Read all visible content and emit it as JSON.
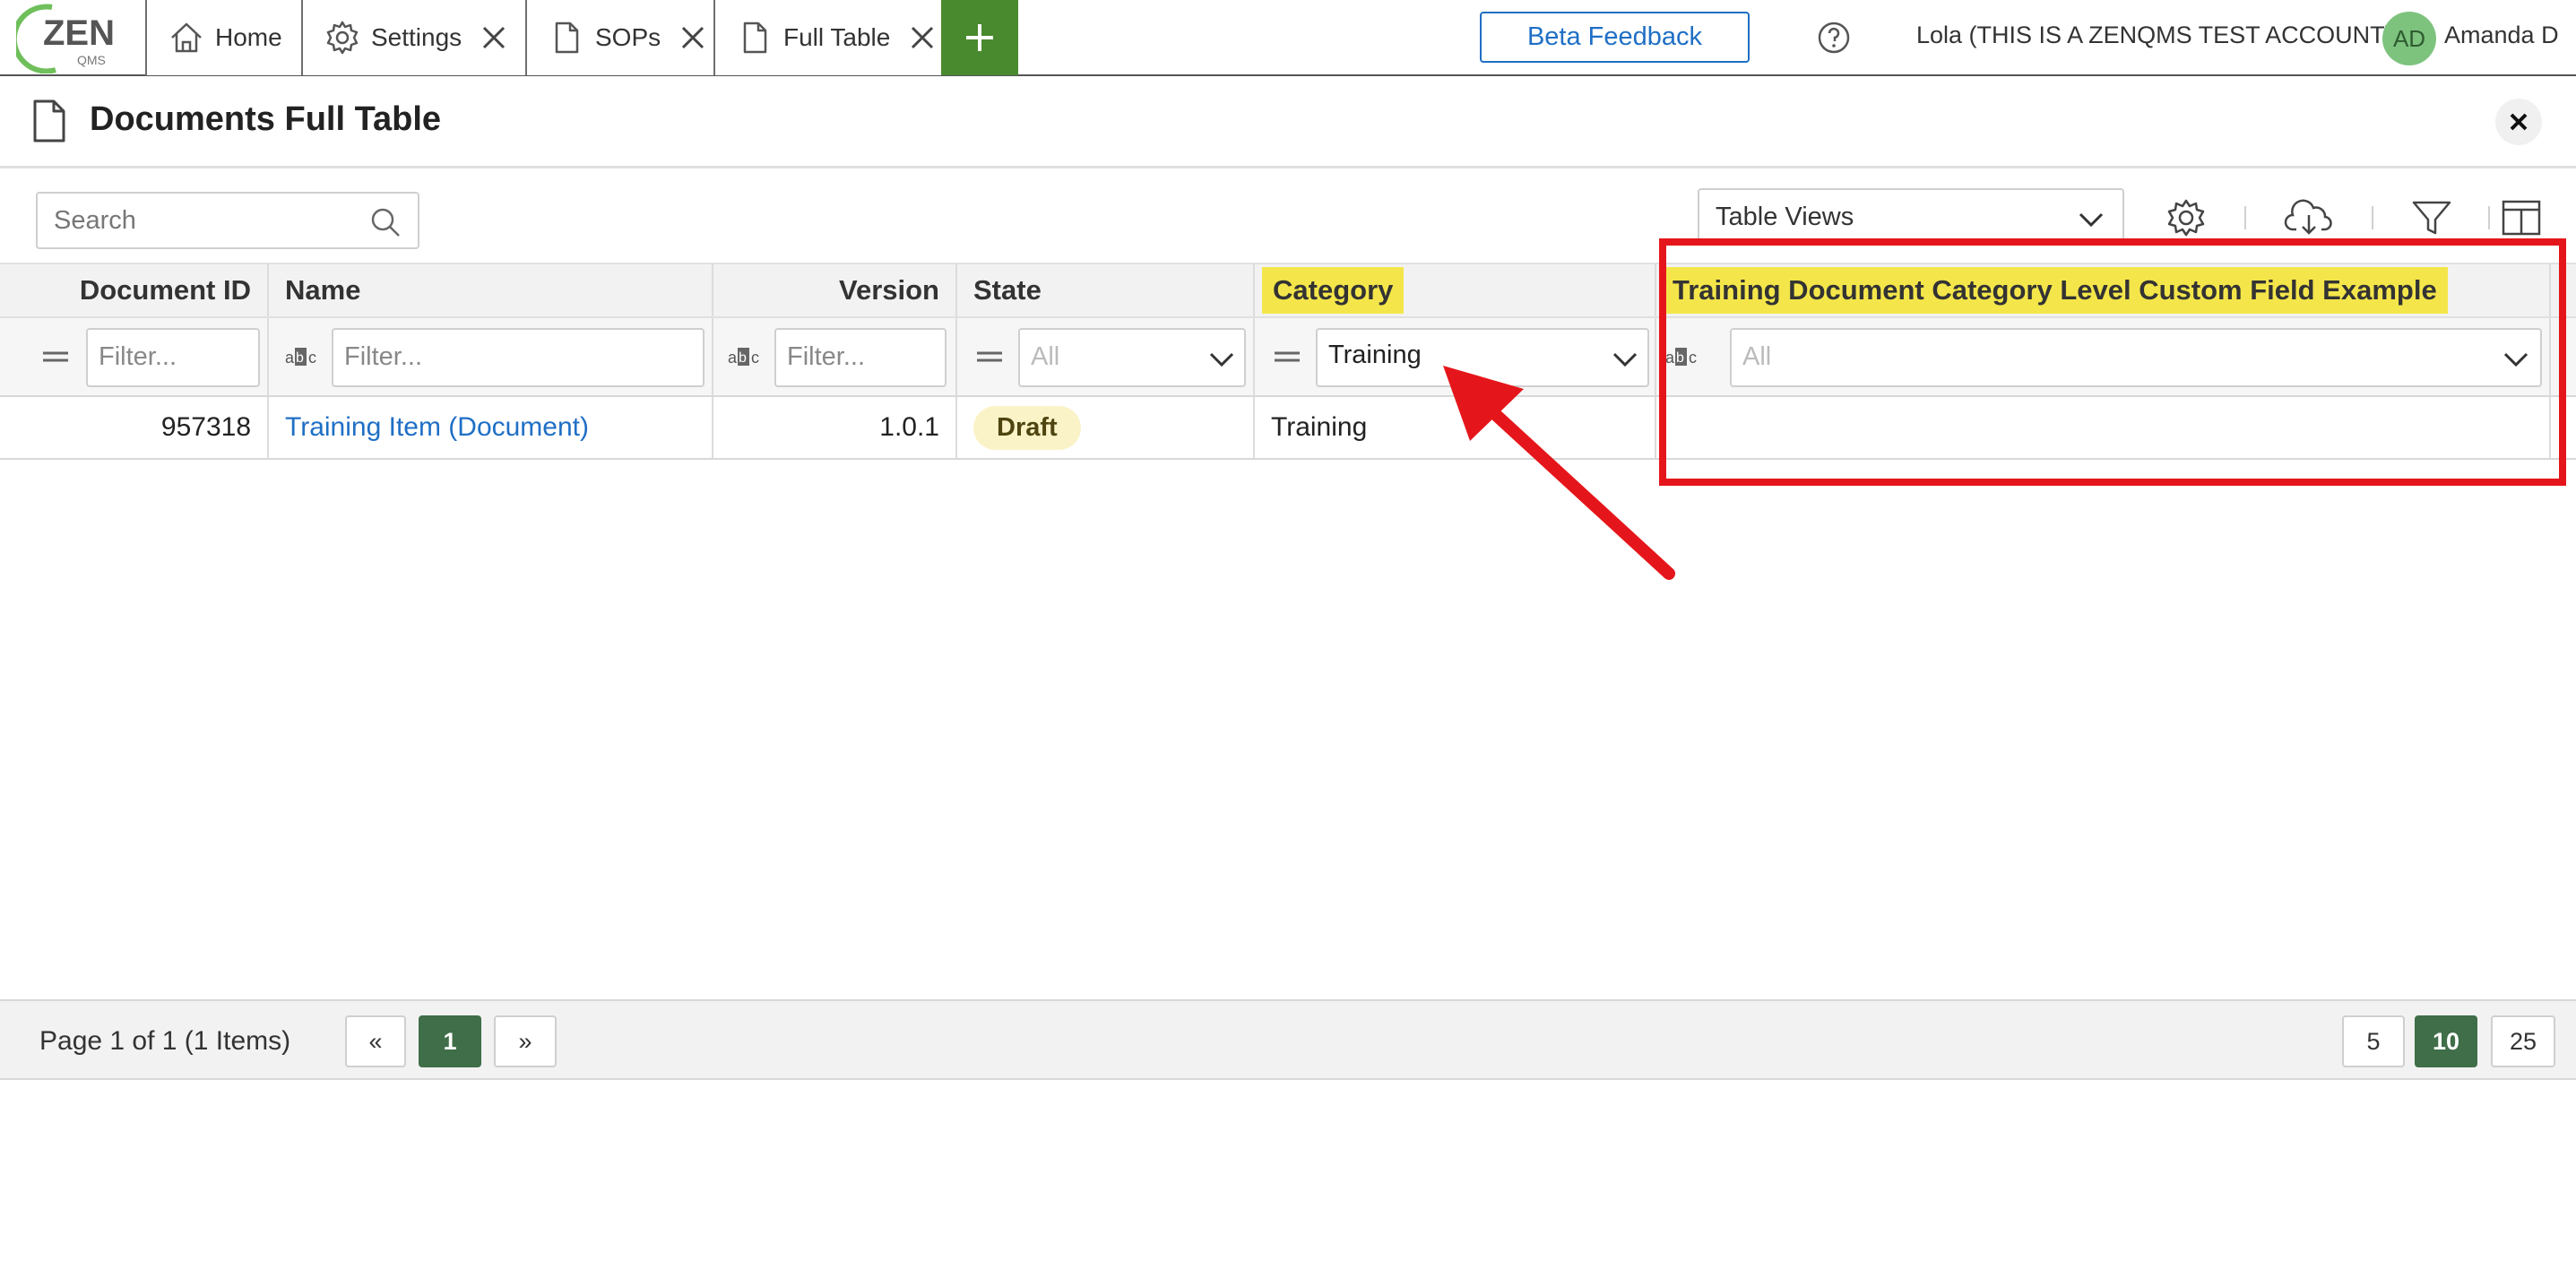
{
  "app": {
    "logo_text": "ZEN",
    "logo_subtext": "QMS"
  },
  "tabs": [
    {
      "label": "Home",
      "icon": "home-icon",
      "closable": false
    },
    {
      "label": "Settings",
      "icon": "gear-icon",
      "closable": true
    },
    {
      "label": "SOPs",
      "icon": "document-icon",
      "closable": true
    },
    {
      "label": "Full Table",
      "icon": "document-icon",
      "closable": true,
      "active": true
    }
  ],
  "header": {
    "beta_feedback": "Beta Feedback",
    "account": "Lola (THIS IS A ZENQMS TEST ACCOUNT)",
    "avatar_initials": "AD",
    "user_name": "Amanda D"
  },
  "page": {
    "title": "Documents Full Table"
  },
  "toolbar": {
    "search_placeholder": "Search",
    "table_views": "Table Views"
  },
  "table": {
    "columns": [
      {
        "label": "Document ID",
        "highlighted": false
      },
      {
        "label": "Name",
        "highlighted": false
      },
      {
        "label": "Version",
        "highlighted": false
      },
      {
        "label": "State",
        "highlighted": false
      },
      {
        "label": "Category",
        "highlighted": true
      },
      {
        "label": "Training Document Category Level Custom Field Example",
        "highlighted": true
      }
    ],
    "filters": {
      "document_id": "Filter...",
      "name": "Filter...",
      "version": "Filter...",
      "state": "All",
      "category": "Training",
      "custom_field": "All"
    },
    "rows": [
      {
        "document_id": "957318",
        "name": "Training Item (Document)",
        "version": "1.0.1",
        "state": "Draft",
        "category": "Training",
        "custom_field": ""
      }
    ]
  },
  "pager": {
    "info": "Page 1 of 1 (1 Items)",
    "prev": "«",
    "current": "1",
    "next": "»",
    "page_sizes": [
      "5",
      "10",
      "25"
    ],
    "selected_page_size": "10"
  },
  "colors": {
    "brand_green": "#4a8a2e",
    "link_blue": "#1f6fc5",
    "highlight_yellow": "#f4e64a",
    "annotation_red": "#e5161b",
    "pager_active": "#3f6e48"
  }
}
